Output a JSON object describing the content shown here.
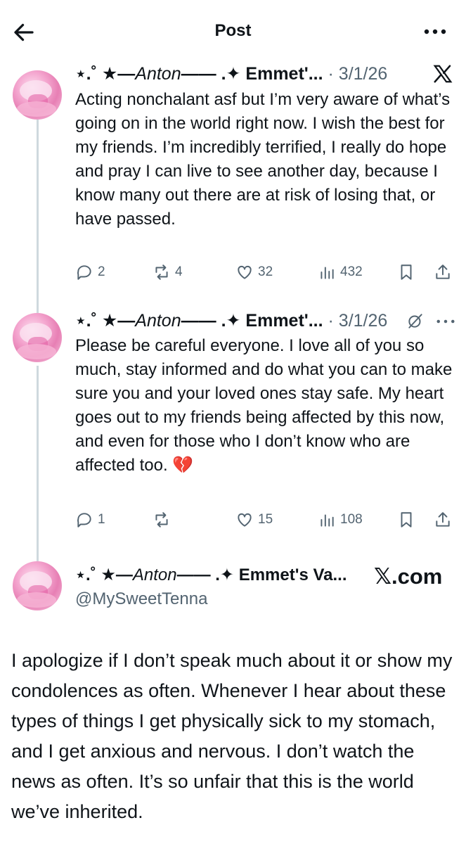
{
  "header": {
    "title": "Post"
  },
  "posts": [
    {
      "name_prefix": "⋆.˚ ★—",
      "name_italic": "Anton",
      "name_suffix": "—— .✦ Emmet'...",
      "date": "· 3/1/26",
      "text": "Acting nonchalant asf but I’m very aware of what’s going on in the world right now. I wish the best for my friends. I’m incredibly terrified, I really do hope and pray I can live to see another day, because I know many out there are at risk of losing that, or have passed.",
      "replies": "2",
      "reposts": "4",
      "likes": "32",
      "views": "432"
    },
    {
      "name_prefix": "⋆.˚ ★—",
      "name_italic": "Anton",
      "name_suffix": "—— .✦ Emmet'...",
      "date": "· 3/1/26",
      "text": "Please be careful everyone. I love all of you so much, stay informed and do what you can to make sure you and your loved ones stay safe. My heart goes out to my friends being affected by this now, and even for those who I don’t know who are affected too. 💔",
      "replies": "1",
      "reposts": "",
      "likes": "15",
      "views": "108"
    }
  ],
  "quote": {
    "name_prefix": "⋆.˚ ★—",
    "name_italic": "Anton",
    "name_suffix": "—— .✦ Emmet's Va...",
    "handle": "@MySweetTenna",
    "source": "𝕏.com"
  },
  "main_text": "I apologize if I don’t speak much about it or show my condolences as often. Whenever I hear about these types of things I get physically sick to my stomach, and I get anxious and nervous. I don’t watch the news as often. It’s so unfair that this is the world we’ve inherited.",
  "icons": [
    "back-arrow-icon",
    "more-icon",
    "x-logo-icon",
    "grok-icon",
    "reply-icon",
    "repost-icon",
    "like-icon",
    "views-icon",
    "bookmark-icon",
    "share-icon"
  ]
}
